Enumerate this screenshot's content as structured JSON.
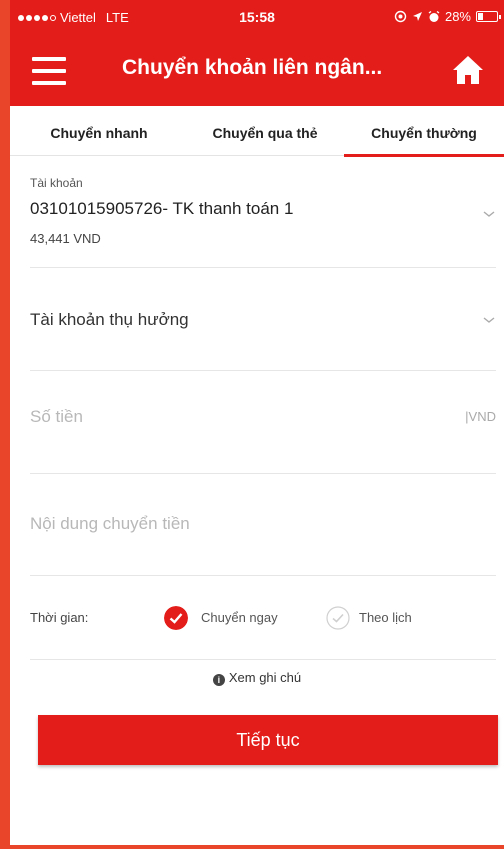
{
  "status_bar": {
    "carrier": "Viettel",
    "network": "LTE",
    "time": "15:58",
    "battery_percent_text": "28%",
    "battery_level": 0.28
  },
  "header": {
    "title": "Chuyển khoản liên ngân...",
    "menu_icon": "hamburger-icon",
    "home_icon": "home-icon",
    "color": "#e31d1a"
  },
  "tabs": [
    {
      "label": "Chuyển nhanh",
      "active": false
    },
    {
      "label": "Chuyển qua thẻ",
      "active": false
    },
    {
      "label": "Chuyển thường",
      "active": true
    }
  ],
  "form": {
    "account": {
      "label": "Tài khoản",
      "value": "03101015905726- TK thanh toán 1",
      "balance": "43,441 VND"
    },
    "beneficiary": {
      "placeholder": "Tài khoản thụ hưởng"
    },
    "amount": {
      "placeholder": "Số tiền",
      "currency": "VND"
    },
    "content": {
      "placeholder": "Nội dung chuyển tiền"
    },
    "time": {
      "label": "Thời gian:",
      "options": [
        {
          "label": "Chuyển ngay",
          "selected": true
        },
        {
          "label": "Theo lịch",
          "selected": false
        }
      ]
    },
    "note_link": "Xem ghi chú",
    "continue_label": "Tiếp tục"
  }
}
